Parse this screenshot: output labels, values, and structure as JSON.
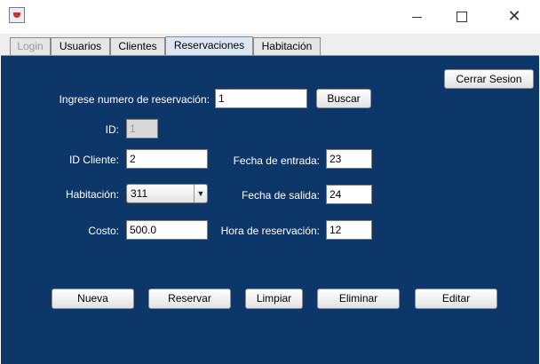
{
  "window": {
    "controls": {
      "minimize": "minimize-icon",
      "maximize": "maximize-icon",
      "close": "close-icon"
    }
  },
  "tabs": [
    {
      "label": "Login",
      "state": "disabled"
    },
    {
      "label": "Usuarios",
      "state": "normal"
    },
    {
      "label": "Clientes",
      "state": "normal"
    },
    {
      "label": "Reservaciones",
      "state": "active"
    },
    {
      "label": "Habitación",
      "state": "normal"
    }
  ],
  "header": {
    "logout_label": "Cerrar Sesion"
  },
  "search": {
    "label": "Ingrese numero de reservación:",
    "value": "1",
    "button_label": "Buscar"
  },
  "form": {
    "id_label": "ID:",
    "id_value": "1",
    "client_label": "ID Cliente:",
    "client_value": "2",
    "room_label": "Habitación:",
    "room_value": "311",
    "cost_label": "Costo:",
    "cost_value": "500.0",
    "checkin_label": "Fecha de entrada:",
    "checkin_value": "23",
    "checkout_label": "Fecha de salida:",
    "checkout_value": "24",
    "time_label": "Hora de reservación:",
    "time_value": "12"
  },
  "actions": {
    "new": "Nueva",
    "reserve": "Reservar",
    "clear": "Limpiar",
    "delete": "Eliminar",
    "edit": "Editar"
  },
  "colors": {
    "panel_bg": "#0e3769",
    "label_text": "#ffffff"
  }
}
